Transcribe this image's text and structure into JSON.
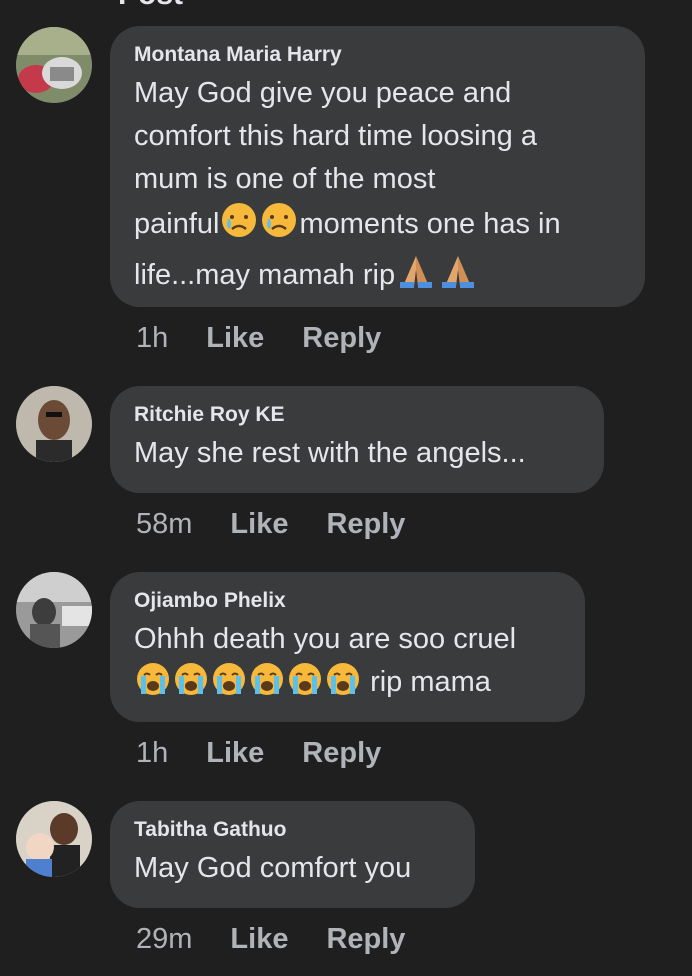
{
  "header": {
    "title": "Post"
  },
  "comments": [
    {
      "author": "Montana Maria Harry",
      "text_lines": [
        "May God give you peace and",
        "comfort this hard time loosing a",
        "mum is one of the most",
        "painful",
        "moments one has in",
        "life...may mamah rip"
      ],
      "time": "1h",
      "like": "Like",
      "reply": "Reply"
    },
    {
      "author": "Ritchie Roy KE",
      "text": "May she rest with the angels...",
      "time": "58m",
      "like": "Like",
      "reply": "Reply"
    },
    {
      "author": "Ojiambo Phelix",
      "text": "Ohhh death you are soo cruel",
      "text2": "rip mama",
      "time": "1h",
      "like": "Like",
      "reply": "Reply"
    },
    {
      "author": "Tabitha Gathuo",
      "text": "May God comfort you",
      "time": "29m",
      "like": "Like",
      "reply": "Reply"
    }
  ],
  "colors": {
    "background": "#1f1f20",
    "bubble": "#3a3b3c",
    "text": "#e4e6eb",
    "muted": "#b0b3b8"
  }
}
